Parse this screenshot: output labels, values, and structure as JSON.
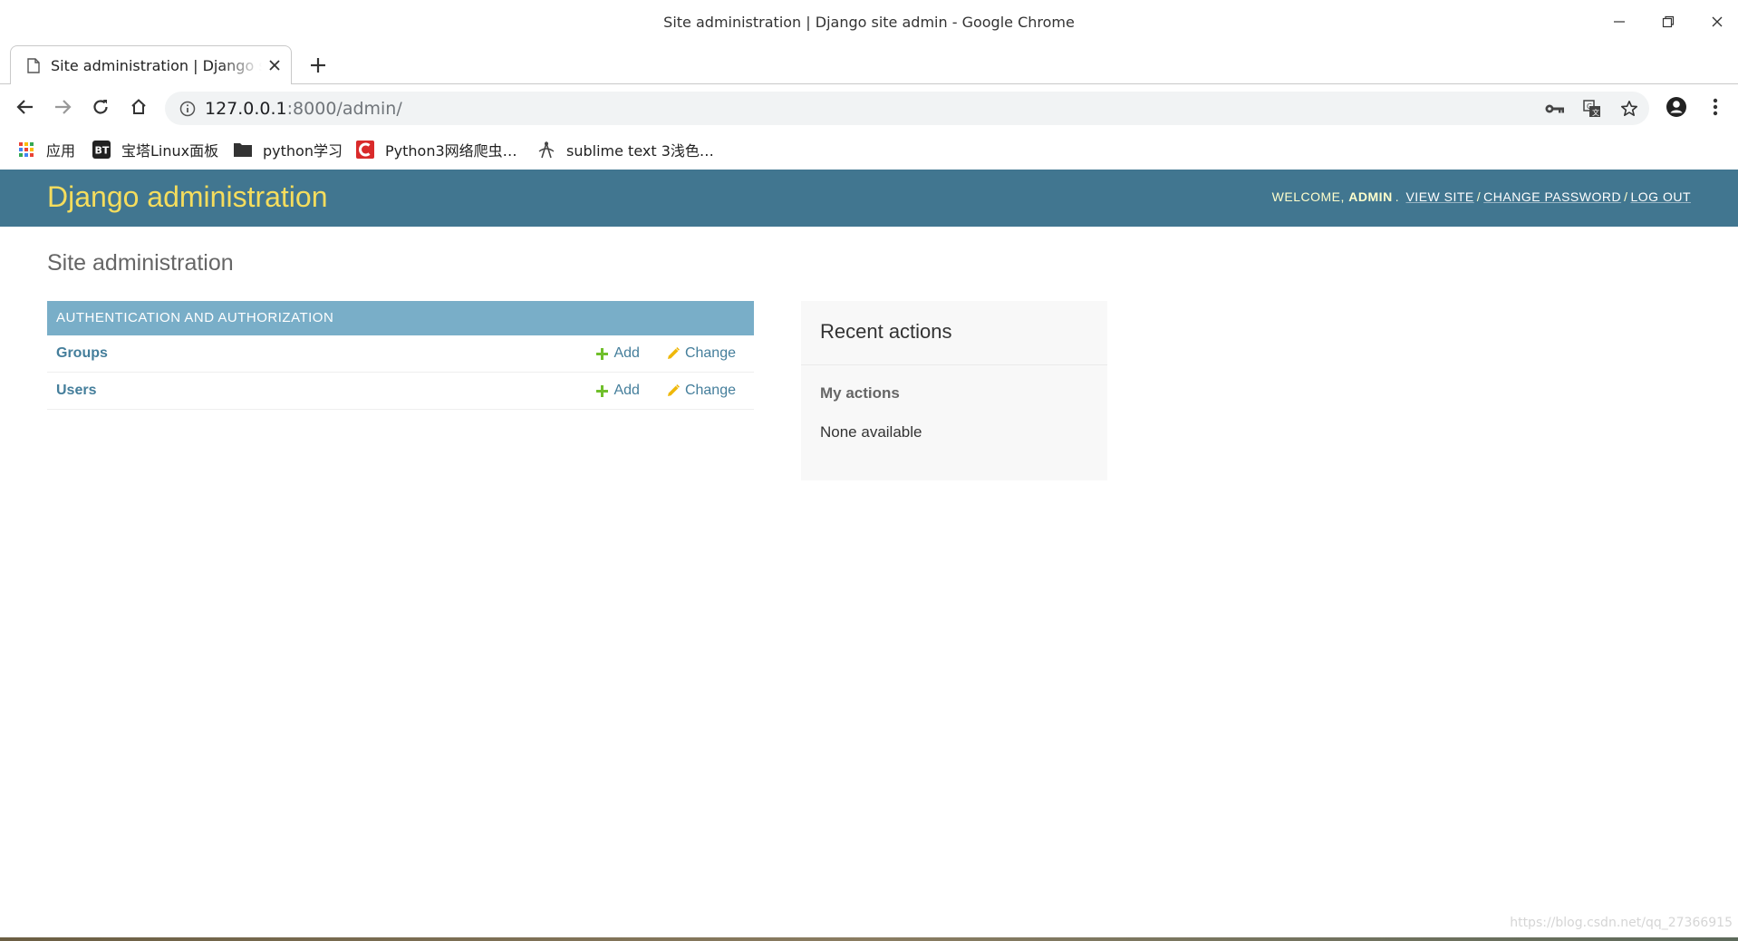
{
  "window": {
    "title": "Site administration | Django site admin - Google Chrome"
  },
  "tab": {
    "title": "Site administration | Django site admin"
  },
  "address_bar": {
    "host": "127.0.0.1",
    "path": ":8000/admin/"
  },
  "bookmarks": [
    {
      "label": "应用",
      "icon": "apps-grid-icon"
    },
    {
      "label": "宝塔Linux面板",
      "icon": "bt-icon"
    },
    {
      "label": "python学习",
      "icon": "folder-icon"
    },
    {
      "label": "Python3网络爬虫…",
      "icon": "csdn-icon"
    },
    {
      "label": "sublime text 3浅色…",
      "icon": "compass-icon"
    }
  ],
  "header": {
    "branding": "Django administration",
    "welcome": "WELCOME,",
    "username": "ADMIN",
    "view_site": "VIEW SITE",
    "change_password": "CHANGE PASSWORD",
    "log_out": "LOG OUT"
  },
  "page_title": "Site administration",
  "module": {
    "caption": "AUTHENTICATION AND AUTHORIZATION",
    "rows": [
      {
        "name": "Groups",
        "add": "Add",
        "change": "Change"
      },
      {
        "name": "Users",
        "add": "Add",
        "change": "Change"
      }
    ]
  },
  "recent_actions": {
    "title": "Recent actions",
    "subtitle": "My actions",
    "empty": "None available"
  },
  "watermark": "https://blog.csdn.net/qq_27366915",
  "colors": {
    "header_bg": "#417690",
    "branding": "#f5dd5d",
    "caption_bg": "#79aec8",
    "link": "#447e9b",
    "add_icon": "#70bf2b",
    "change_icon": "#efb80b"
  }
}
